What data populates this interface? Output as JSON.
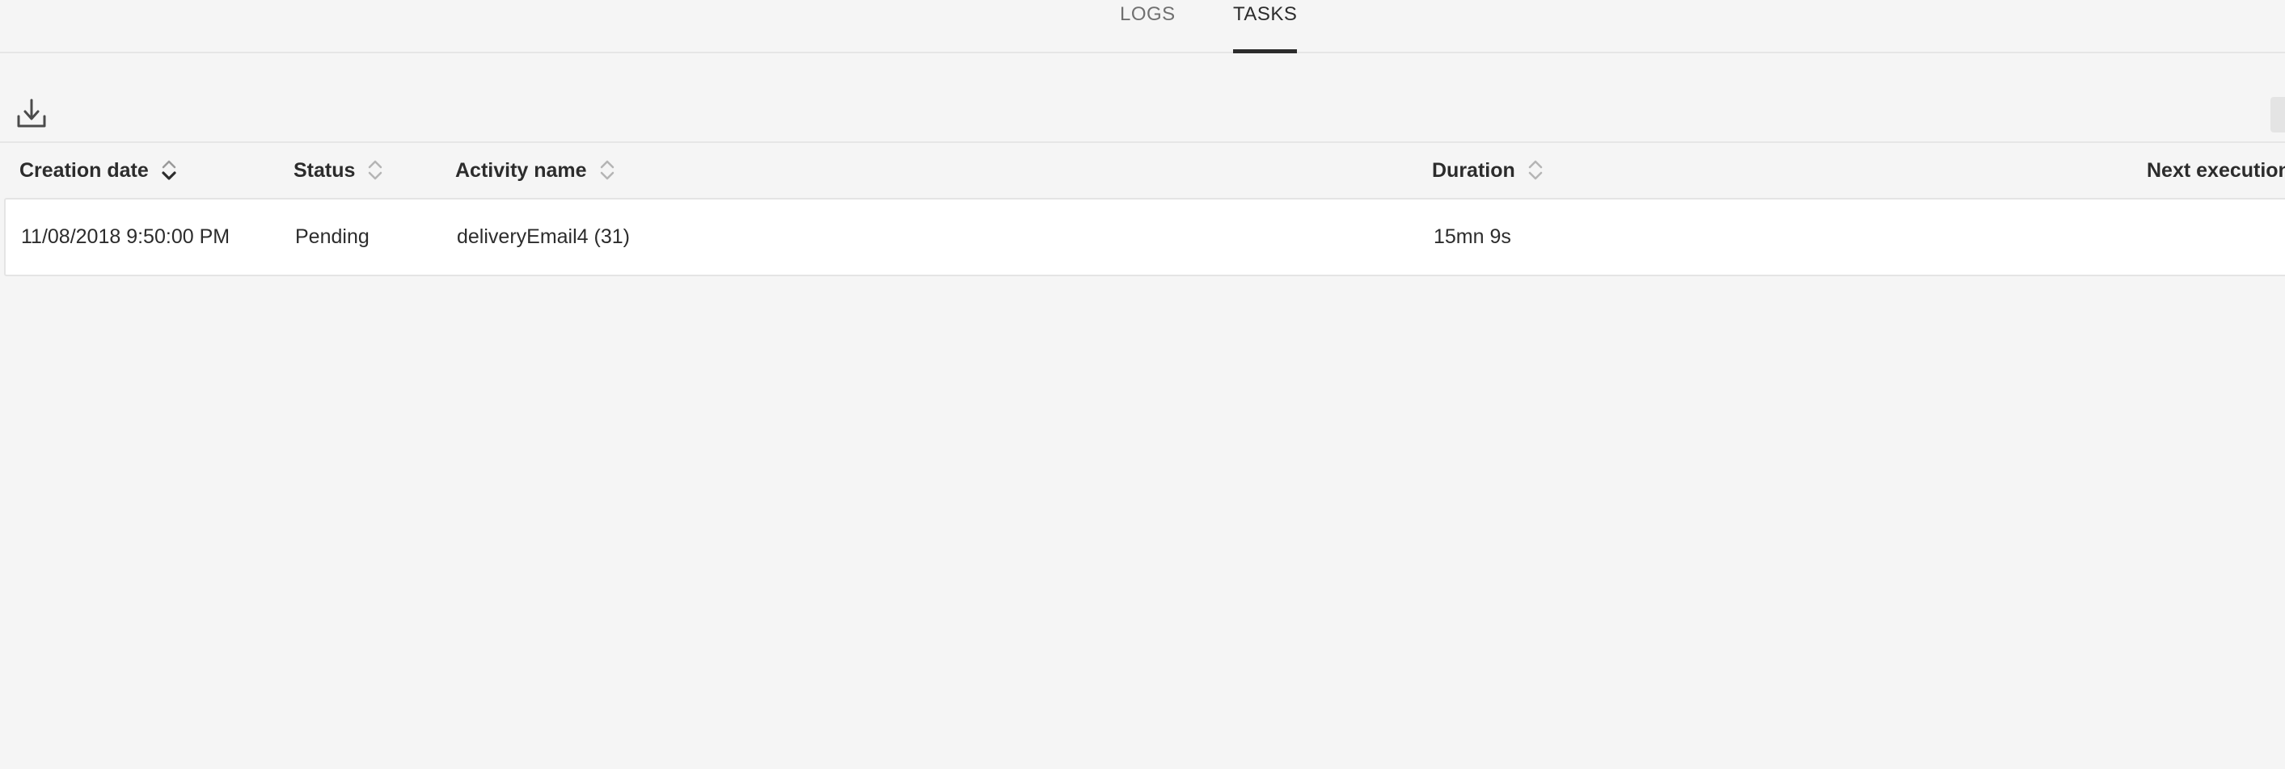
{
  "tabs": [
    {
      "label": "LOGS",
      "active": false
    },
    {
      "label": "TASKS",
      "active": true
    }
  ],
  "toolbar": {
    "download_icon": "download-icon"
  },
  "table": {
    "columns": [
      {
        "label": "Creation date",
        "sort": "active"
      },
      {
        "label": "Status",
        "sort": "none"
      },
      {
        "label": "Activity name",
        "sort": "none"
      },
      {
        "label": "Duration",
        "sort": "none"
      },
      {
        "label": "Next execution",
        "sort": "none"
      }
    ],
    "rows": [
      {
        "creation_date": "11/08/2018 9:50:00 PM",
        "status": "Pending",
        "activity_name": "deliveryEmail4 (31)",
        "duration": "15mn 9s",
        "next_execution": ""
      }
    ]
  },
  "colors": {
    "background": "#f5f5f5",
    "text": "#2c2c2c",
    "muted_text": "#707070",
    "row_background": "#ffffff",
    "border": "#e4e4e4"
  }
}
